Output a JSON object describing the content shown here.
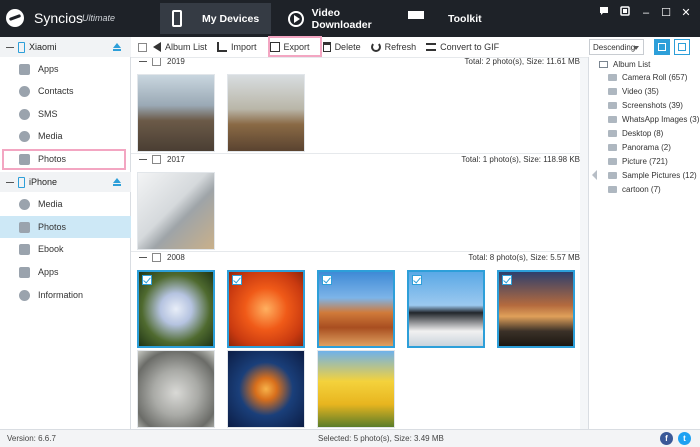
{
  "app": {
    "name": "Syncios",
    "edition": "Ultimate"
  },
  "nav": {
    "tabs": [
      {
        "label": "My Devices"
      },
      {
        "label": "Video Downloader"
      },
      {
        "label": "Toolkit"
      }
    ]
  },
  "window_controls": {
    "feedback": "feedback-icon",
    "settings": "settings-icon",
    "minimize": "–",
    "maximize": "☐",
    "close": "✕"
  },
  "sidebar": {
    "devices": [
      {
        "name": "Xiaomi",
        "items": [
          {
            "label": "Apps"
          },
          {
            "label": "Contacts"
          },
          {
            "label": "SMS"
          },
          {
            "label": "Media"
          },
          {
            "label": "Photos"
          }
        ]
      },
      {
        "name": "iPhone",
        "items": [
          {
            "label": "Media"
          },
          {
            "label": "Photos"
          },
          {
            "label": "Ebook"
          },
          {
            "label": "Apps"
          },
          {
            "label": "Information"
          }
        ]
      }
    ]
  },
  "toolbar": {
    "album_list": "Album List",
    "import": "Import",
    "export": "Export",
    "delete": "Delete",
    "refresh": "Refresh",
    "convert_gif": "Convert to GIF"
  },
  "sort": {
    "selected": "Descending"
  },
  "groups": [
    {
      "year": "2019",
      "summary": "Total: 2 photo(s), Size: 11.61 MB"
    },
    {
      "year": "2017",
      "summary": "Total: 1 photo(s), Size: 118.98 KB"
    },
    {
      "year": "2008",
      "summary": "Total: 8 photo(s), Size: 5.57 MB"
    }
  ],
  "albums": {
    "title": "Album List",
    "items": [
      {
        "label": "Camera Roll (657)"
      },
      {
        "label": "Video (35)"
      },
      {
        "label": "Screenshots (39)"
      },
      {
        "label": "WhatsApp Images (3)"
      },
      {
        "label": "Desktop (8)"
      },
      {
        "label": "Panorama (2)"
      },
      {
        "label": "Picture (721)"
      },
      {
        "label": "Sample Pictures (12)"
      },
      {
        "label": "cartoon (7)"
      }
    ]
  },
  "status": {
    "version": "Version: 6.6.7",
    "selection": "Selected: 5 photo(s), Size: 3.49 MB"
  },
  "colors": {
    "titlebar": "#1e2228",
    "accent": "#2d9fd9",
    "highlight": "#f3a6c2",
    "selected_row": "#cde8f6"
  }
}
